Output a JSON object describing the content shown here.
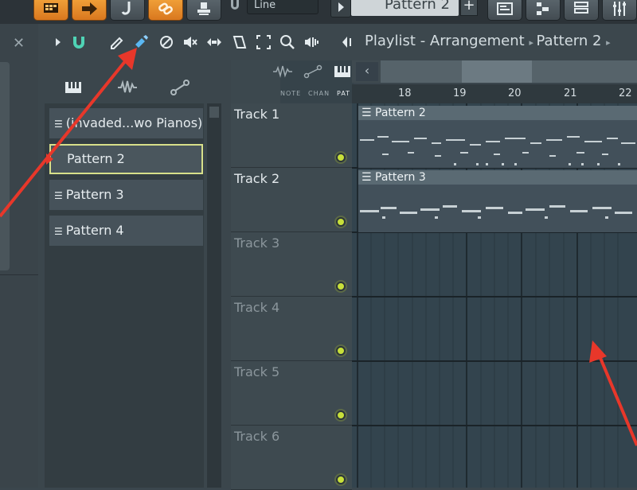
{
  "toolbar": {
    "snap_value": "Line",
    "pattern_value": "Pattern 2",
    "pattern_add_label": "+"
  },
  "browser": {
    "close_label": "✕"
  },
  "playlist": {
    "title": "Playlist - Arrangement",
    "breadcrumb_pattern": "Pattern 2",
    "column_labels": [
      "NOTE",
      "CHAN",
      "PAT"
    ]
  },
  "picker": {
    "items": [
      {
        "label": "(invaded...wo Pianos)",
        "selected": false
      },
      {
        "label": "Pattern 2",
        "selected": true
      },
      {
        "label": "Pattern 3",
        "selected": false
      },
      {
        "label": "Pattern 4",
        "selected": false
      }
    ]
  },
  "ruler": {
    "bars": [
      "18",
      "19",
      "20",
      "21",
      "22"
    ]
  },
  "tracks": [
    {
      "name": "Track 1"
    },
    {
      "name": "Track 2"
    },
    {
      "name": "Track 3"
    },
    {
      "name": "Track 4"
    },
    {
      "name": "Track 5"
    },
    {
      "name": "Track 6"
    }
  ],
  "clips": [
    {
      "label": "Pattern 2"
    },
    {
      "label": "Pattern 3"
    }
  ],
  "colors": {
    "accent_orange": "#e8902c",
    "selection_outline": "#d8e08a",
    "track_dot": "#c8e03a",
    "annotation_arrow": "#e8372a"
  }
}
